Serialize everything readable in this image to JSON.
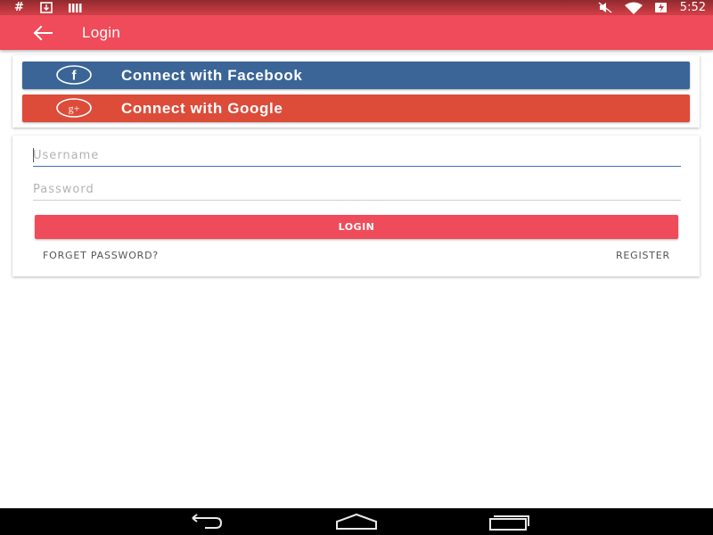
{
  "status_bar": {
    "left_icons": [
      "hash-icon",
      "download-icon",
      "signal-bars-icon"
    ],
    "left_hash": "#",
    "right_icons": [
      "mute-icon",
      "wifi-icon",
      "battery-charging-icon"
    ],
    "time": "5:52"
  },
  "app_bar": {
    "title": "Login",
    "back_icon": "arrow-back-icon"
  },
  "social": {
    "facebook_label": "Connect with Facebook",
    "facebook_icon": "facebook-icon",
    "google_label": "Connect with Google",
    "google_icon": "google-plus-icon"
  },
  "form": {
    "username_placeholder": "Username",
    "username_value": "",
    "password_placeholder": "Password",
    "password_value": "",
    "login_label": "LOGIN",
    "forget_label": "FORGET PASSWORD?",
    "register_label": "REGISTER"
  },
  "nav_bar": {
    "icons": [
      "back-nav-icon",
      "home-nav-icon",
      "recents-nav-icon"
    ]
  },
  "colors": {
    "accent": "#f04b5a",
    "facebook": "#3b6597",
    "google": "#dd4b39",
    "input_focus": "#3f6fb0"
  }
}
